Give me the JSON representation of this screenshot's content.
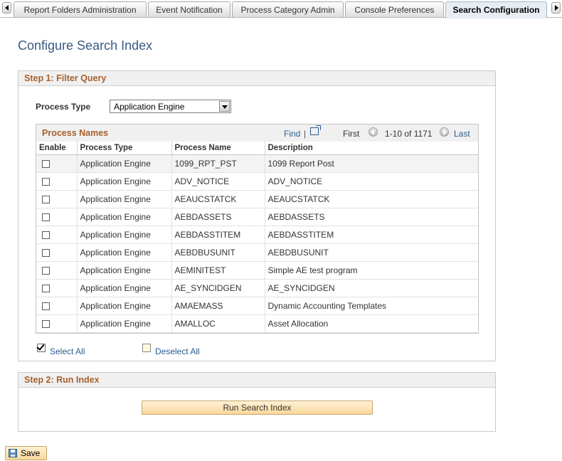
{
  "tabs": [
    {
      "label": "Report Folders Administration",
      "active": false
    },
    {
      "label": "Event Notification",
      "active": false
    },
    {
      "label": "Process Category Admin",
      "active": false
    },
    {
      "label": "Console Preferences",
      "active": false
    },
    {
      "label": "Search Configuration",
      "active": true
    }
  ],
  "page_title": "Configure Search Index",
  "step1": {
    "title": "Step 1: Filter Query",
    "process_type_label": "Process Type",
    "process_type_value": "Application Engine"
  },
  "grid": {
    "title": "Process Names",
    "find": "Find",
    "sep": "|",
    "first": "First",
    "range": "1-10 of 1171",
    "last": "Last",
    "columns": [
      "Enable",
      "Process Type",
      "Process Name",
      "Description"
    ],
    "rows": [
      {
        "type": "Application Engine",
        "name": "1099_RPT_PST",
        "desc": "1099 Report Post"
      },
      {
        "type": "Application Engine",
        "name": "ADV_NOTICE",
        "desc": "ADV_NOTICE"
      },
      {
        "type": "Application Engine",
        "name": "AEAUCSTATCK",
        "desc": "AEAUCSTATCK"
      },
      {
        "type": "Application Engine",
        "name": "AEBDASSETS",
        "desc": "AEBDASSETS"
      },
      {
        "type": "Application Engine",
        "name": "AEBDASSTITEM",
        "desc": "AEBDASSTITEM"
      },
      {
        "type": "Application Engine",
        "name": "AEBDBUSUNIT",
        "desc": "AEBDBUSUNIT"
      },
      {
        "type": "Application Engine",
        "name": "AEMINITEST",
        "desc": "Simple AE test program"
      },
      {
        "type": "Application Engine",
        "name": "AE_SYNCIDGEN",
        "desc": "AE_SYNCIDGEN"
      },
      {
        "type": "Application Engine",
        "name": "AMAEMASS",
        "desc": "Dynamic Accounting Templates"
      },
      {
        "type": "Application Engine",
        "name": "AMALLOC",
        "desc": "Asset Allocation"
      }
    ]
  },
  "select_all": "Select All",
  "deselect_all": "Deselect All",
  "step2": {
    "title": "Step 2: Run Index",
    "run_button": "Run Search Index"
  },
  "save_button": "Save"
}
